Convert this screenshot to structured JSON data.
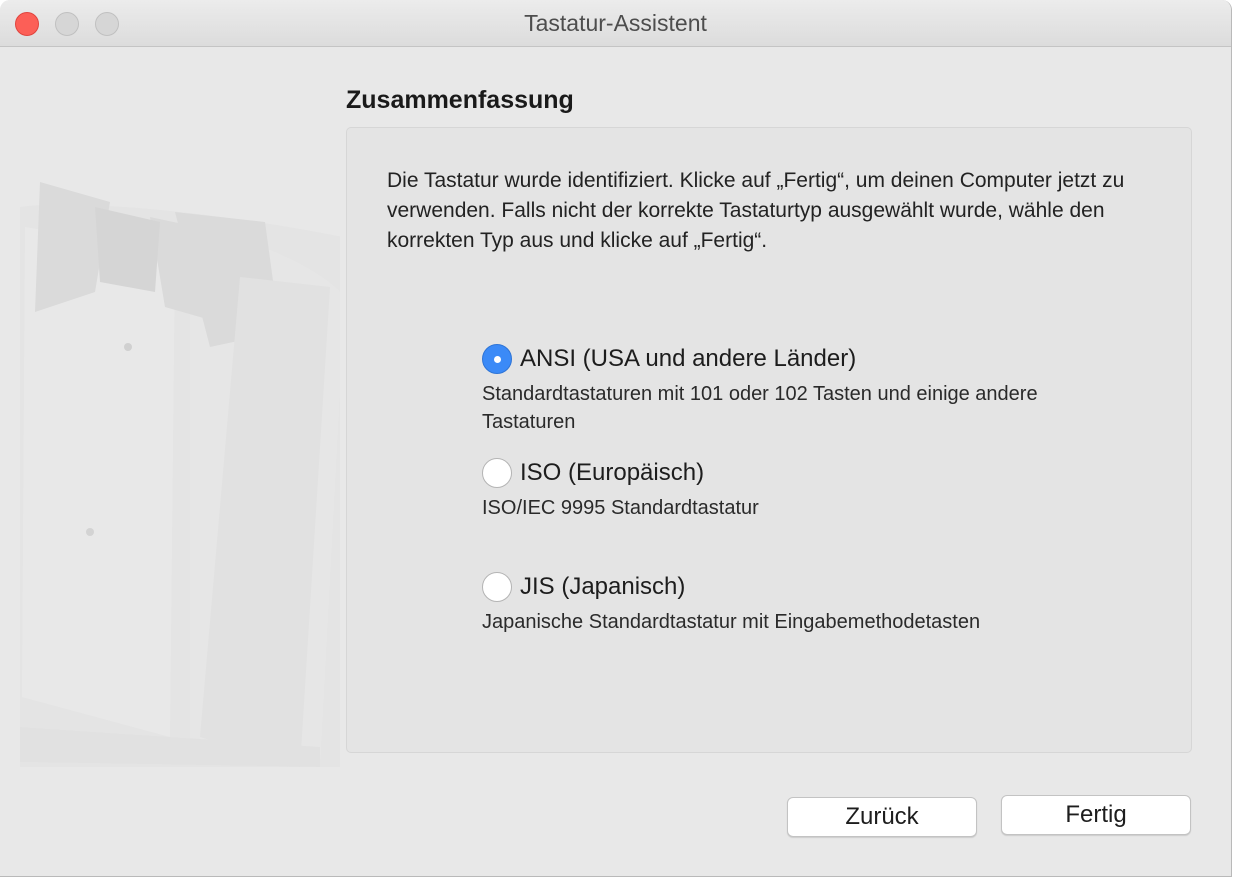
{
  "window": {
    "title": "Tastatur-Assistent"
  },
  "section_title": "Zusammenfassung",
  "summary_text": "Die Tastatur wurde identifiziert. Klicke auf „Fertig“, um deinen Computer jetzt zu verwenden. Falls nicht der korrekte Tastaturtyp ausgewählt wurde, wähle den korrekten Typ aus und klicke auf „Fertig“.",
  "options": [
    {
      "label": "ANSI (USA und andere Länder)",
      "description": "Standardtastaturen mit 101 oder 102 Tasten und einige andere Tastaturen",
      "selected": true
    },
    {
      "label": "ISO (Europäisch)",
      "description": "ISO/IEC 9995 Standardtastatur",
      "selected": false
    },
    {
      "label": "JIS (Japanisch)",
      "description": "Japanische Standardtastatur mit Eingabemethodetasten",
      "selected": false
    }
  ],
  "buttons": {
    "back": "Zurück",
    "done": "Fertig"
  },
  "colors": {
    "close": "#fc5f57",
    "accent": "#3b8af7"
  }
}
